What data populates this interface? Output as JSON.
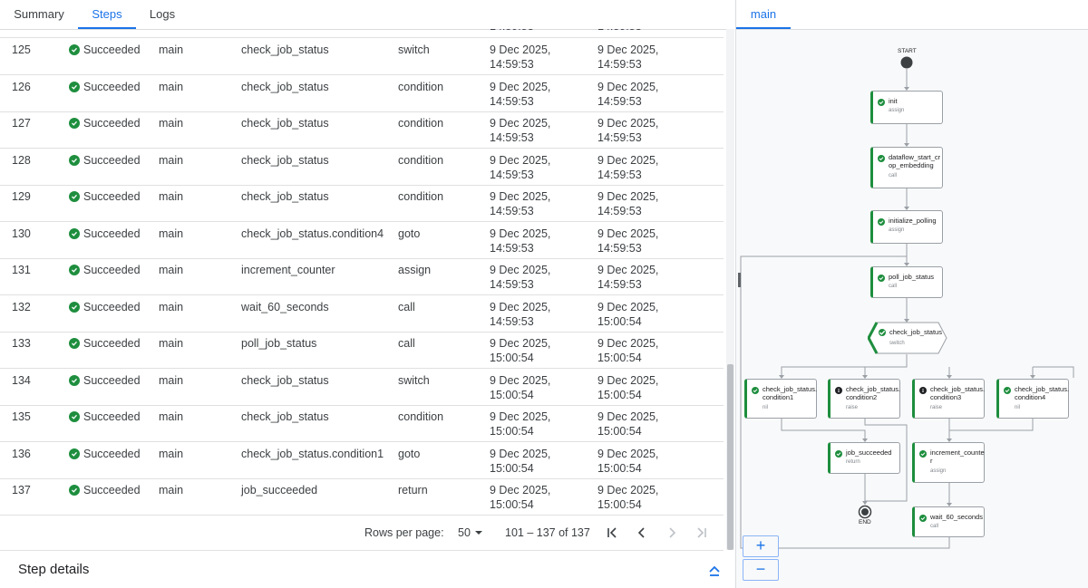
{
  "tabs": [
    "Summary",
    "Steps",
    "Logs"
  ],
  "active_tab": "Steps",
  "rows": [
    {
      "num": "125",
      "status": "Succeeded",
      "routine": "main",
      "step": "check_job_status",
      "type": "switch",
      "start": [
        "9 Dec 2025,",
        "14:59:53"
      ],
      "end": [
        "9 Dec 2025,",
        "14:59:53"
      ]
    },
    {
      "num": "126",
      "status": "Succeeded",
      "routine": "main",
      "step": "check_job_status",
      "type": "condition",
      "start": [
        "9 Dec 2025,",
        "14:59:53"
      ],
      "end": [
        "9 Dec 2025,",
        "14:59:53"
      ]
    },
    {
      "num": "127",
      "status": "Succeeded",
      "routine": "main",
      "step": "check_job_status",
      "type": "condition",
      "start": [
        "9 Dec 2025,",
        "14:59:53"
      ],
      "end": [
        "9 Dec 2025,",
        "14:59:53"
      ]
    },
    {
      "num": "128",
      "status": "Succeeded",
      "routine": "main",
      "step": "check_job_status",
      "type": "condition",
      "start": [
        "9 Dec 2025,",
        "14:59:53"
      ],
      "end": [
        "9 Dec 2025,",
        "14:59:53"
      ]
    },
    {
      "num": "129",
      "status": "Succeeded",
      "routine": "main",
      "step": "check_job_status",
      "type": "condition",
      "start": [
        "9 Dec 2025,",
        "14:59:53"
      ],
      "end": [
        "9 Dec 2025,",
        "14:59:53"
      ]
    },
    {
      "num": "130",
      "status": "Succeeded",
      "routine": "main",
      "step": "check_job_status.condition4",
      "type": "goto",
      "start": [
        "9 Dec 2025,",
        "14:59:53"
      ],
      "end": [
        "9 Dec 2025,",
        "14:59:53"
      ]
    },
    {
      "num": "131",
      "status": "Succeeded",
      "routine": "main",
      "step": "increment_counter",
      "type": "assign",
      "start": [
        "9 Dec 2025,",
        "14:59:53"
      ],
      "end": [
        "9 Dec 2025,",
        "14:59:53"
      ]
    },
    {
      "num": "132",
      "status": "Succeeded",
      "routine": "main",
      "step": "wait_60_seconds",
      "type": "call",
      "start": [
        "9 Dec 2025,",
        "14:59:53"
      ],
      "end": [
        "9 Dec 2025,",
        "15:00:54"
      ]
    },
    {
      "num": "133",
      "status": "Succeeded",
      "routine": "main",
      "step": "poll_job_status",
      "type": "call",
      "start": [
        "9 Dec 2025,",
        "15:00:54"
      ],
      "end": [
        "9 Dec 2025,",
        "15:00:54"
      ]
    },
    {
      "num": "134",
      "status": "Succeeded",
      "routine": "main",
      "step": "check_job_status",
      "type": "switch",
      "start": [
        "9 Dec 2025,",
        "15:00:54"
      ],
      "end": [
        "9 Dec 2025,",
        "15:00:54"
      ]
    },
    {
      "num": "135",
      "status": "Succeeded",
      "routine": "main",
      "step": "check_job_status",
      "type": "condition",
      "start": [
        "9 Dec 2025,",
        "15:00:54"
      ],
      "end": [
        "9 Dec 2025,",
        "15:00:54"
      ]
    },
    {
      "num": "136",
      "status": "Succeeded",
      "routine": "main",
      "step": "check_job_status.condition1",
      "type": "goto",
      "start": [
        "9 Dec 2025,",
        "15:00:54"
      ],
      "end": [
        "9 Dec 2025,",
        "15:00:54"
      ]
    },
    {
      "num": "137",
      "status": "Succeeded",
      "routine": "main",
      "step": "job_succeeded",
      "type": "return",
      "start": [
        "9 Dec 2025,",
        "15:00:54"
      ],
      "end": [
        "9 Dec 2025,",
        "15:00:54"
      ]
    }
  ],
  "pager": {
    "rows_label": "Rows per page:",
    "rows_value": "50",
    "range": "101 – 137 of 137"
  },
  "details": {
    "title": "Step details"
  },
  "graph": {
    "tab": "main",
    "start_label": "START",
    "end_label": "END",
    "zoom_in": "+",
    "zoom_out": "−",
    "nodes": [
      {
        "id": "init",
        "name": "init",
        "type": "assign",
        "icon": "check"
      },
      {
        "id": "dataflow",
        "name": "dataflow_start_cr op_embedding",
        "type": "call",
        "icon": "check"
      },
      {
        "id": "initpoll",
        "name": "initialize_polling",
        "type": "assign",
        "icon": "check"
      },
      {
        "id": "poll",
        "name": "poll_job_status",
        "type": "call",
        "icon": "check"
      },
      {
        "id": "switch",
        "name": "check_job_status",
        "type": "switch",
        "icon": "check"
      },
      {
        "id": "c1",
        "name": "check_job_status. condition1",
        "type": "nil",
        "icon": "check"
      },
      {
        "id": "c2",
        "name": "check_job_status. condition2",
        "type": "raise",
        "icon": "info"
      },
      {
        "id": "c3",
        "name": "check_job_status. condition3",
        "type": "raise",
        "icon": "info"
      },
      {
        "id": "c4",
        "name": "check_job_status. condition4",
        "type": "nil",
        "icon": "check"
      },
      {
        "id": "succ",
        "name": "job_succeeded",
        "type": "return",
        "icon": "check"
      },
      {
        "id": "inc",
        "name": "increment_counte r",
        "type": "assign",
        "icon": "check"
      },
      {
        "id": "wait",
        "name": "wait_60_seconds",
        "type": "call",
        "icon": "check"
      }
    ]
  }
}
